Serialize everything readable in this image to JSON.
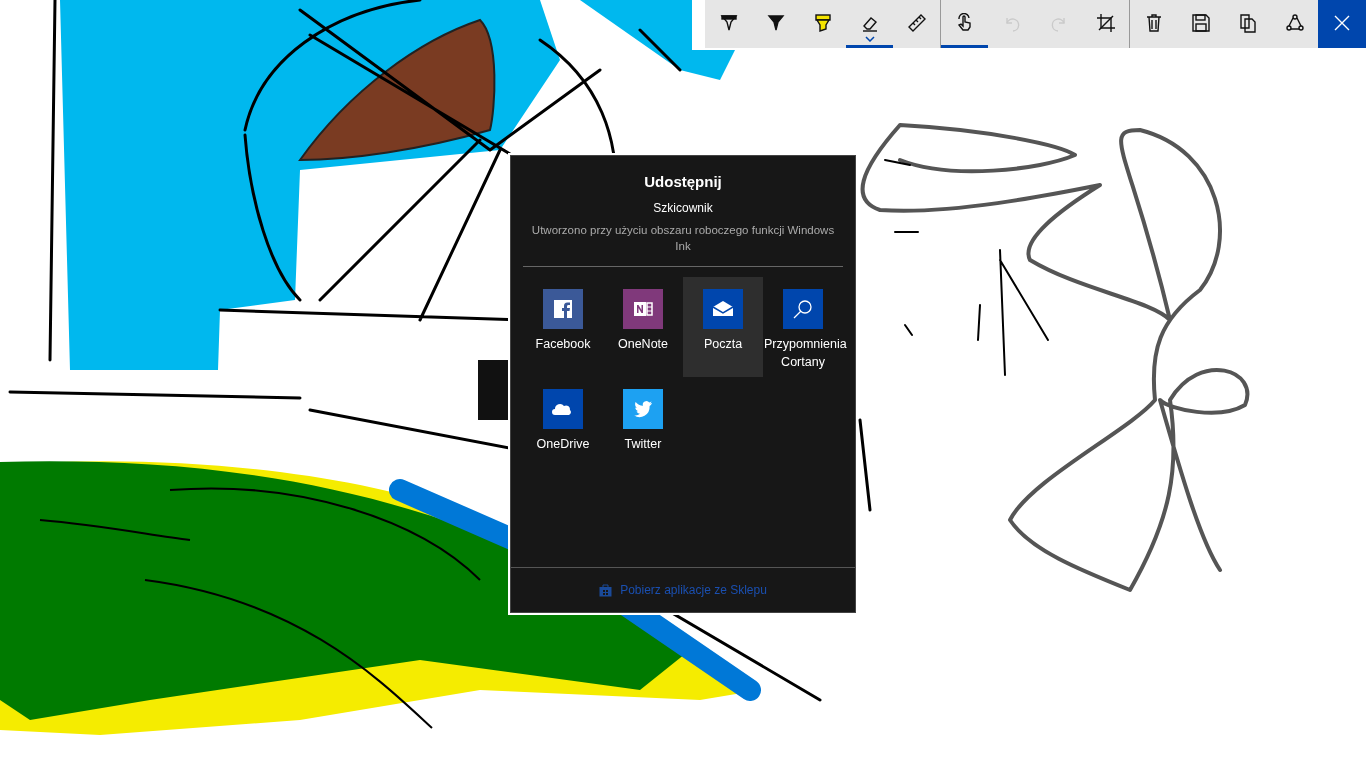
{
  "toolbar": {
    "tools": [
      {
        "kind": "ballpoint",
        "selected": false,
        "disabled": false
      },
      {
        "kind": "pencil",
        "selected": false,
        "disabled": false
      },
      {
        "kind": "highlighter",
        "selected": false,
        "disabled": false
      },
      {
        "kind": "eraser",
        "selected": true,
        "disabled": false
      },
      {
        "kind": "ruler",
        "selected": false,
        "disabled": false
      },
      {
        "kind": "touch",
        "selected": true,
        "disabled": false
      },
      {
        "kind": "undo",
        "selected": false,
        "disabled": true
      },
      {
        "kind": "redo",
        "selected": false,
        "disabled": true
      },
      {
        "kind": "crop",
        "selected": false,
        "disabled": false
      },
      {
        "kind": "delete",
        "selected": false,
        "disabled": false
      },
      {
        "kind": "save",
        "selected": false,
        "disabled": false
      },
      {
        "kind": "copy",
        "selected": false,
        "disabled": false
      },
      {
        "kind": "share",
        "selected": false,
        "disabled": false
      },
      {
        "kind": "close",
        "selected": false,
        "disabled": false
      }
    ]
  },
  "share_panel": {
    "title": "Udostępnij",
    "app_name": "Szkicownik",
    "description": "Utworzono przy użyciu obszaru roboczego funkcji Windows Ink",
    "apps": [
      {
        "kind": "facebook",
        "label": "Facebook",
        "color": "#3b5998",
        "selected": false
      },
      {
        "kind": "onenote",
        "label": "OneNote",
        "color": "#80397b",
        "selected": false
      },
      {
        "kind": "mail",
        "label": "Poczta",
        "color": "#0046ad",
        "selected": true
      },
      {
        "kind": "cortana",
        "label": "Przypomnienia Cortany",
        "color": "#0046ad",
        "selected": false
      },
      {
        "kind": "onedrive",
        "label": "OneDrive",
        "color": "#0046ad",
        "selected": false
      },
      {
        "kind": "twitter",
        "label": "Twitter",
        "color": "#1da1f2",
        "selected": false
      }
    ],
    "store_link": "Pobierz aplikacje ze Sklepu"
  }
}
